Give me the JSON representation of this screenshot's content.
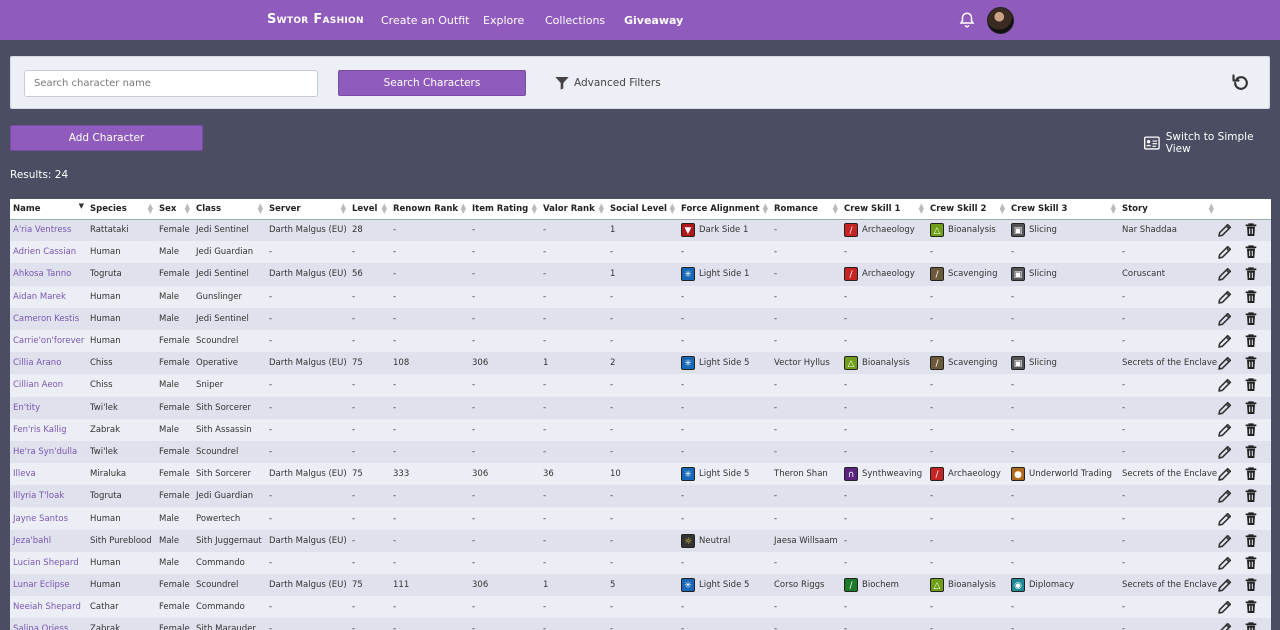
{
  "nav": {
    "brand": "Swtor Fashion",
    "links": [
      "Create an Outfit",
      "Explore",
      "Collections",
      "Giveaway"
    ]
  },
  "search": {
    "placeholder": "Search character name",
    "button": "Search Characters",
    "advanced": "Advanced Filters"
  },
  "actions": {
    "add": "Add Character",
    "switch_view": "Switch to Simple View",
    "results": "Results: 24"
  },
  "colors": {
    "accent": "#8f5bbd",
    "background": "#4b4e63",
    "row_odd": "#dfe2ec",
    "row_even": "#eceef5"
  },
  "columns": [
    "Name",
    "Species",
    "Sex",
    "Class",
    "Server",
    "Level",
    "Renown Rank",
    "Item Rating",
    "Valor Rank",
    "Social Level",
    "Force Alignment",
    "Romance",
    "Crew Skill 1",
    "Crew Skill 2",
    "Crew Skill 3",
    "Story",
    ""
  ],
  "rows": [
    [
      "A'ria Ventress",
      "Rattataki",
      "Female",
      "Jedi Sentinel",
      "Darth Malgus (EU)",
      "28",
      "-",
      "-",
      "-",
      "1",
      "Dark Side 1",
      "-",
      "Archaeology",
      "Bioanalysis",
      "Slicing",
      "Nar Shaddaa"
    ],
    [
      "Adrien Cassian",
      "Human",
      "Male",
      "Jedi Guardian",
      "-",
      "-",
      "-",
      "-",
      "-",
      "-",
      "-",
      "-",
      "-",
      "-",
      "-",
      "-"
    ],
    [
      "Ahkosa Tanno",
      "Togruta",
      "Female",
      "Jedi Sentinel",
      "Darth Malgus (EU)",
      "56",
      "-",
      "-",
      "-",
      "1",
      "Light Side 1",
      "-",
      "Archaeology",
      "Scavenging",
      "Slicing",
      "Coruscant"
    ],
    [
      "Aidan Marek",
      "Human",
      "Male",
      "Gunslinger",
      "-",
      "-",
      "-",
      "-",
      "-",
      "-",
      "-",
      "-",
      "-",
      "-",
      "-",
      "-"
    ],
    [
      "Cameron Kestis",
      "Human",
      "Male",
      "Jedi Sentinel",
      "-",
      "-",
      "-",
      "-",
      "-",
      "-",
      "-",
      "-",
      "-",
      "-",
      "-",
      "-"
    ],
    [
      "Carrie'on'forever",
      "Human",
      "Female",
      "Scoundrel",
      "-",
      "-",
      "-",
      "-",
      "-",
      "-",
      "-",
      "-",
      "-",
      "-",
      "-",
      "-"
    ],
    [
      "Cillia Arano",
      "Chiss",
      "Female",
      "Operative",
      "Darth Malgus (EU)",
      "75",
      "108",
      "306",
      "1",
      "2",
      "Light Side 5",
      "Vector Hyllus",
      "Bioanalysis",
      "Scavenging",
      "Slicing",
      "Secrets of the Enclave"
    ],
    [
      "Cillian Aeon",
      "Chiss",
      "Male",
      "Sniper",
      "-",
      "-",
      "-",
      "-",
      "-",
      "-",
      "-",
      "-",
      "-",
      "-",
      "-",
      "-"
    ],
    [
      "En'tity",
      "Twi'lek",
      "Female",
      "Sith Sorcerer",
      "-",
      "-",
      "-",
      "-",
      "-",
      "-",
      "-",
      "-",
      "-",
      "-",
      "-",
      "-"
    ],
    [
      "Fen'ris Kallig",
      "Zabrak",
      "Male",
      "Sith Assassin",
      "-",
      "-",
      "-",
      "-",
      "-",
      "-",
      "-",
      "-",
      "-",
      "-",
      "-",
      "-"
    ],
    [
      "He'ra Syn'dulla",
      "Twi'lek",
      "Female",
      "Scoundrel",
      "-",
      "-",
      "-",
      "-",
      "-",
      "-",
      "-",
      "-",
      "-",
      "-",
      "-",
      "-"
    ],
    [
      "Illeva",
      "Miraluka",
      "Female",
      "Sith Sorcerer",
      "Darth Malgus (EU)",
      "75",
      "333",
      "306",
      "36",
      "10",
      "Light Side 5",
      "Theron Shan",
      "Synthweaving",
      "Archaeology",
      "Underworld Trading",
      "Secrets of the Enclave"
    ],
    [
      "Illyria T'loak",
      "Togruta",
      "Female",
      "Jedi Guardian",
      "-",
      "-",
      "-",
      "-",
      "-",
      "-",
      "-",
      "-",
      "-",
      "-",
      "-",
      "-"
    ],
    [
      "Jayne Santos",
      "Human",
      "Male",
      "Powertech",
      "-",
      "-",
      "-",
      "-",
      "-",
      "-",
      "-",
      "-",
      "-",
      "-",
      "-",
      "-"
    ],
    [
      "Jeza'bahl",
      "Sith Pureblood",
      "Male",
      "Sith Juggernaut",
      "Darth Malgus (EU)",
      "-",
      "-",
      "-",
      "-",
      "-",
      "Neutral",
      "Jaesa Willsaam",
      "-",
      "-",
      "-",
      "-"
    ],
    [
      "Lucian Shepard",
      "Human",
      "Male",
      "Commando",
      "-",
      "-",
      "-",
      "-",
      "-",
      "-",
      "-",
      "-",
      "-",
      "-",
      "-",
      "-"
    ],
    [
      "Lunar Eclipse",
      "Human",
      "Female",
      "Scoundrel",
      "Darth Malgus (EU)",
      "75",
      "111",
      "306",
      "1",
      "5",
      "Light Side 5",
      "Corso Riggs",
      "Biochem",
      "Bioanalysis",
      "Diplomacy",
      "Secrets of the Enclave"
    ],
    [
      "Neeiah Shepard",
      "Cathar",
      "Female",
      "Commando",
      "-",
      "-",
      "-",
      "-",
      "-",
      "-",
      "-",
      "-",
      "-",
      "-",
      "-",
      "-"
    ],
    [
      "Salina Oriess",
      "Zabrak",
      "Female",
      "Sith Marauder",
      "-",
      "-",
      "-",
      "-",
      "-",
      "-",
      "-",
      "-",
      "-",
      "-",
      "-",
      "-"
    ]
  ],
  "icon_map": {
    "Dark Side 1": "dark-side-icon",
    "Light Side 1": "light-side-icon",
    "Light Side 5": "light-side-icon",
    "Neutral": "neutral-icon",
    "Archaeology": "archaeology-icon",
    "Bioanalysis": "bioanalysis-icon",
    "Slicing": "slicing-icon",
    "Scavenging": "scavenging-icon",
    "Synthweaving": "synthweaving-icon",
    "Underworld Trading": "underworld-trading-icon",
    "Biochem": "biochem-icon",
    "Diplomacy": "diplomacy-icon"
  }
}
